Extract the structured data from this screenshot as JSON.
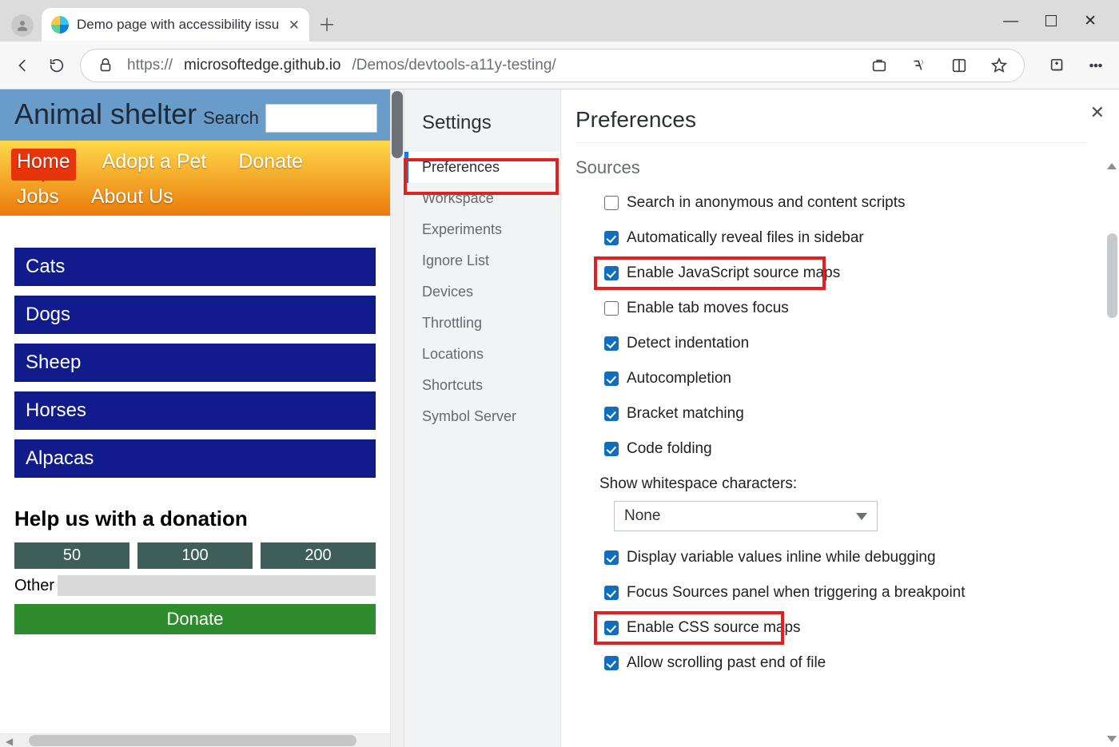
{
  "window": {
    "tab_title": "Demo page with accessibility issu",
    "url_prefix": "https://",
    "url_host": "microsoftedge.github.io",
    "url_path": "/Demos/devtools-a11y-testing/"
  },
  "page": {
    "site_title": "Animal shelter",
    "search_label": "Search",
    "nav_items": [
      "Home",
      "Adopt a Pet",
      "Donate",
      "Jobs",
      "About Us"
    ],
    "nav_active_index": 0,
    "categories": [
      "Cats",
      "Dogs",
      "Sheep",
      "Horses",
      "Alpacas"
    ],
    "donation_heading": "Help us with a donation",
    "donation_amounts": [
      "50",
      "100",
      "200"
    ],
    "other_label": "Other",
    "donate_button": "Donate"
  },
  "devtools": {
    "sidebar_title": "Settings",
    "categories": [
      "Preferences",
      "Workspace",
      "Experiments",
      "Ignore List",
      "Devices",
      "Throttling",
      "Locations",
      "Shortcuts",
      "Symbol Server"
    ],
    "active_category_index": 0,
    "panel_title": "Preferences",
    "section_title": "Sources",
    "show_whitespace_label": "Show whitespace characters:",
    "show_whitespace_value": "None",
    "options": [
      {
        "label": "Search in anonymous and content scripts",
        "checked": false
      },
      {
        "label": "Automatically reveal files in sidebar",
        "checked": true
      },
      {
        "label": "Enable JavaScript source maps",
        "checked": true
      },
      {
        "label": "Enable tab moves focus",
        "checked": false
      },
      {
        "label": "Detect indentation",
        "checked": true
      },
      {
        "label": "Autocompletion",
        "checked": true
      },
      {
        "label": "Bracket matching",
        "checked": true
      },
      {
        "label": "Code folding",
        "checked": true
      },
      {
        "label": "Display variable values inline while debugging",
        "checked": true
      },
      {
        "label": "Focus Sources panel when triggering a breakpoint",
        "checked": true
      },
      {
        "label": "Enable CSS source maps",
        "checked": true
      },
      {
        "label": "Allow scrolling past end of file",
        "checked": true
      }
    ]
  }
}
